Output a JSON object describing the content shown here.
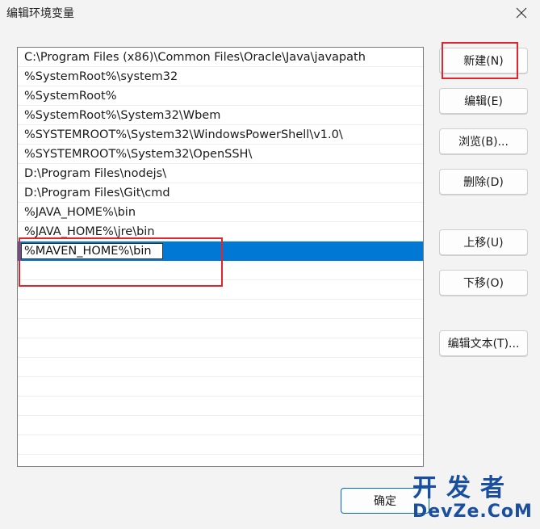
{
  "window": {
    "title": "编辑环境变量",
    "close_icon": "close-icon"
  },
  "list": {
    "items": [
      "C:\\Program Files (x86)\\Common Files\\Oracle\\Java\\javapath",
      "%SystemRoot%\\system32",
      "%SystemRoot%",
      "%SystemRoot%\\System32\\Wbem",
      "%SYSTEMROOT%\\System32\\WindowsPowerShell\\v1.0\\",
      "%SYSTEMROOT%\\System32\\OpenSSH\\",
      "D:\\Program Files\\nodejs\\",
      "D:\\Program Files\\Git\\cmd",
      "%JAVA_HOME%\\bin",
      "%JAVA_HOME%\\jre\\bin"
    ],
    "editing_value": "%MAVEN_HOME%\\bin"
  },
  "buttons": {
    "new": "新建(N)",
    "edit": "编辑(E)",
    "browse": "浏览(B)...",
    "delete": "删除(D)",
    "move_up": "上移(U)",
    "move_down": "下移(O)",
    "edit_text": "编辑文本(T)...",
    "ok": "确定"
  },
  "watermark": {
    "top": "开发者",
    "bottom": "DevZe.CoM"
  },
  "colors": {
    "selection": "#0078d4",
    "highlight_box": "#e0262c",
    "ok_border": "#0067c0"
  }
}
